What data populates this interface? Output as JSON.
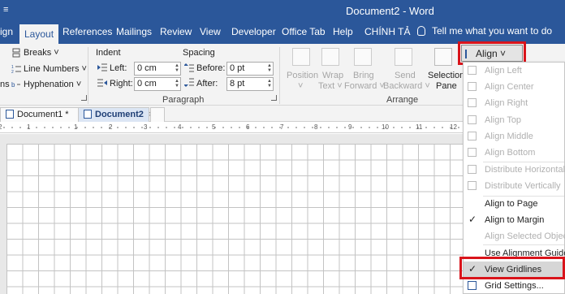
{
  "app": {
    "title": "Document2 - Word",
    "qat_glyph": "≡"
  },
  "tabs": [
    {
      "label": "ign"
    },
    {
      "label": "Layout"
    },
    {
      "label": "References"
    },
    {
      "label": "Mailings"
    },
    {
      "label": "Review"
    },
    {
      "label": "View"
    },
    {
      "label": "Developer"
    },
    {
      "label": "Office Tab"
    },
    {
      "label": "Help"
    },
    {
      "label": "CHÍNH TẢ"
    }
  ],
  "tell_me": "Tell me what you want to do",
  "page_setup": {
    "left_edge": "ns",
    "breaks": "Breaks ˅",
    "line_numbers": "Line Numbers ˅",
    "hyphenation": "Hyphenation ˅"
  },
  "paragraph": {
    "group_name": "Paragraph",
    "indent_header": "Indent",
    "spacing_header": "Spacing",
    "left_label": "Left:",
    "left_value": "0 cm",
    "right_label": "Right:",
    "right_value": "0 cm",
    "before_label": "Before:",
    "before_value": "0 pt",
    "after_label": "After:",
    "after_value": "8 pt"
  },
  "arrange": {
    "group_name": "Arrange",
    "position": [
      "Position",
      "˅"
    ],
    "wrap_text": [
      "Wrap",
      "Text ˅"
    ],
    "bring_forward": [
      "Bring",
      "Forward ˅"
    ],
    "send_backward": [
      "Send",
      "Backward ˅"
    ],
    "selection_pane": [
      "Selection",
      "Pane"
    ],
    "align_button": "Align ˅"
  },
  "doc_tabs": [
    {
      "label": "Document1 *",
      "close": ""
    },
    {
      "label": "Document2",
      "close": "×"
    }
  ],
  "ruler_numbers": [
    "2",
    "1",
    "1",
    "2",
    "3",
    "4",
    "5",
    "6",
    "7",
    "8",
    "9",
    "10",
    "11",
    "12"
  ],
  "align_menu": [
    {
      "label": "Align Left",
      "enabled": false
    },
    {
      "label": "Align Center",
      "enabled": false
    },
    {
      "label": "Align Right",
      "enabled": false
    },
    {
      "label": "Align Top",
      "enabled": false
    },
    {
      "label": "Align Middle",
      "enabled": false
    },
    {
      "label": "Align Bottom",
      "enabled": false
    },
    {
      "label": "Distribute Horizontally",
      "enabled": false
    },
    {
      "label": "Distribute Vertically",
      "enabled": false
    },
    {
      "label": "Align to Page",
      "enabled": true
    },
    {
      "label": "Align to Margin",
      "enabled": true,
      "checked": true
    },
    {
      "label": "Align Selected Objects",
      "enabled": false
    },
    {
      "label": "Use Alignment Guides",
      "enabled": true
    },
    {
      "label": "View Gridlines",
      "enabled": true,
      "checked": true
    },
    {
      "label": "Grid Settings...",
      "enabled": true
    }
  ],
  "colors": {
    "accent": "#2b579a",
    "highlight": "#d9141b"
  }
}
